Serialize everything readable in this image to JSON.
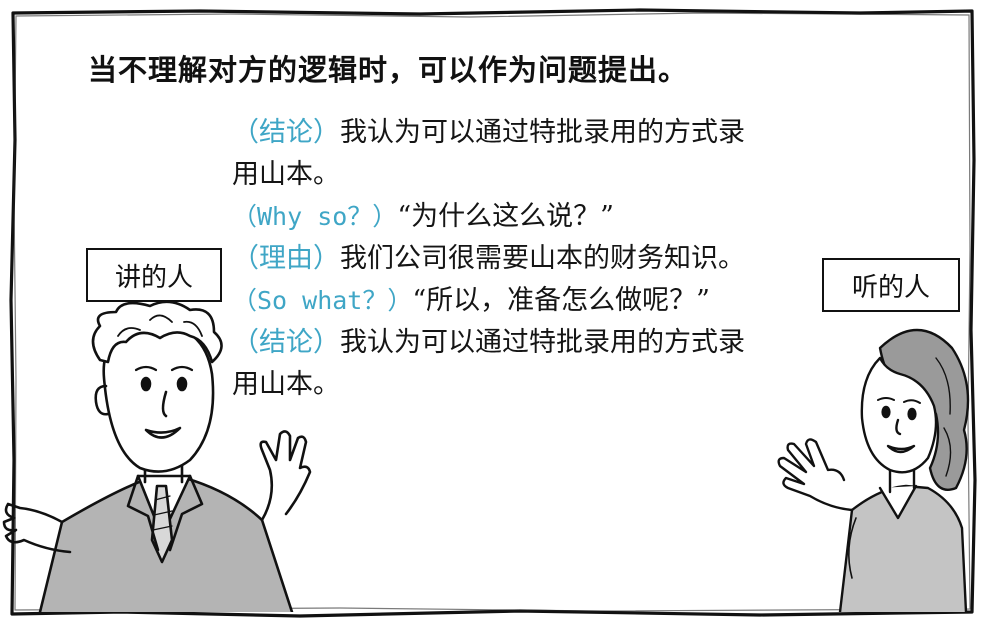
{
  "heading": "当不理解对方的逻辑时，可以作为问题提出。",
  "speaker_label": "讲的人",
  "listener_label": "听的人",
  "dialog": {
    "l1": {
      "tag": "（结论）",
      "text": "我认为可以通过特批录用的方式录"
    },
    "l2": {
      "text": "用山本。"
    },
    "l3": {
      "tag": "（Why so？）",
      "text": "“为什么这么说？”"
    },
    "l4": {
      "tag": "（理由）",
      "text": "我们公司很需要山本的财务知识。"
    },
    "l5": {
      "tag": "（So what？）",
      "text": "“所以，准备怎么做呢？”"
    },
    "l6": {
      "tag": "（结论）",
      "text": "我认为可以通过特批录用的方式录"
    },
    "l7": {
      "text": "用山本。"
    }
  },
  "colors": {
    "tag": "#3fa6c6",
    "ink": "#111111"
  }
}
